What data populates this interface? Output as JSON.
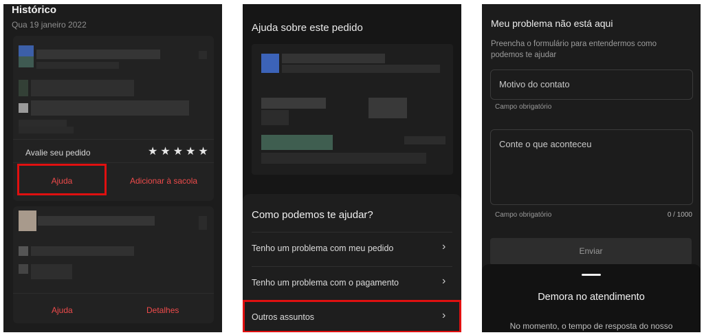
{
  "panel1": {
    "title": "Histórico",
    "date": "Qua 19 janeiro 2022",
    "rate_label": "Avalie seu pedido",
    "stars": [
      "★",
      "★",
      "★",
      "★",
      "★"
    ],
    "help_button": "Ajuda",
    "add_to_bag_button": "Adicionar à sacola",
    "help_button_2": "Ajuda",
    "details_button": "Detalhes"
  },
  "panel2": {
    "order_help_title": "Ajuda sobre este pedido",
    "how_can_we_help": "Como podemos te ajudar?",
    "options": [
      {
        "label": "Tenho um problema com meu pedido"
      },
      {
        "label": "Tenho um problema com o pagamento"
      },
      {
        "label": "Outros assuntos"
      }
    ],
    "chevron": "›"
  },
  "panel3": {
    "title": "Meu problema não está aqui",
    "description": "Preencha o formulário para entendermos como podemos te ajudar",
    "reason_placeholder": "Motivo do contato",
    "required_1": "Campo obrigatório",
    "details_placeholder": "Conte o que aconteceu",
    "required_2": "Campo obrigatório",
    "char_count": "0 / 1000",
    "send_button": "Enviar",
    "sheet_title": "Demora no atendimento",
    "sheet_text": "No momento, o tempo de resposta do nosso"
  },
  "colors": {
    "accent_red": "#ef4b4b",
    "highlight_border": "#e01010",
    "panel_bg": "#1c1c1c"
  }
}
